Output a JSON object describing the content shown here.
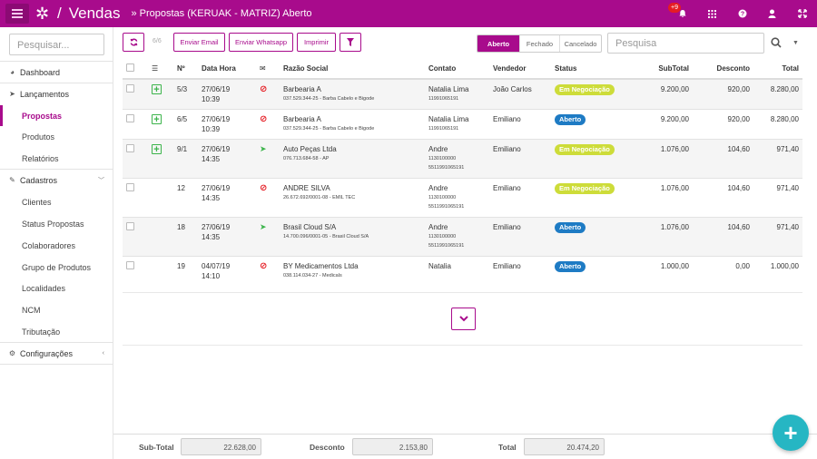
{
  "app": {
    "name": "Vendas",
    "breadcrumb": "» Propostas (KERUAK - MATRIZ) Aberto",
    "slash": "/"
  },
  "topbar": {
    "notification_count": "+9",
    "icons": [
      "bell-icon",
      "grid-icon",
      "help-icon",
      "user-icon",
      "expand-icon"
    ]
  },
  "sidebar": {
    "search_placeholder": "Pesquisar...",
    "items": [
      {
        "label": "Dashboard",
        "icon": "dashboard-icon"
      },
      {
        "label": "Lançamentos",
        "icon": "send-icon"
      },
      {
        "label": "Propostas"
      },
      {
        "label": "Produtos"
      },
      {
        "label": "Relatórios"
      },
      {
        "label": "Cadastros",
        "icon": "edit-icon"
      },
      {
        "label": "Clientes"
      },
      {
        "label": "Status Propostas"
      },
      {
        "label": "Colaboradores"
      },
      {
        "label": "Grupo de Produtos"
      },
      {
        "label": "Localidades"
      },
      {
        "label": "NCM"
      },
      {
        "label": "Tributação"
      },
      {
        "label": "Configurações",
        "icon": "gear-icon"
      }
    ]
  },
  "toolbar": {
    "count": "6/6",
    "email": "Enviar Email",
    "whatsapp": "Enviar Whatsapp",
    "print": "Imprimir",
    "status_filter": [
      "Aberto",
      "Fechado",
      "Cancelado"
    ],
    "search_placeholder": "Pesquisa"
  },
  "table": {
    "headers": {
      "num": "Nº",
      "date": "Data Hora",
      "company": "Razão Social",
      "contact": "Contato",
      "seller": "Vendedor",
      "status": "Status",
      "subtotal": "SubTotal",
      "discount": "Desconto",
      "total": "Total"
    },
    "rows": [
      {
        "num": "5/3",
        "date": "27/06/19",
        "time": "10:39",
        "company": "Barbearia A",
        "company_detail": "037.529.344-25 - Barba Cabelo e Bigode",
        "contact": "Natalia Lima",
        "contact_lines": [
          "11991065191"
        ],
        "seller": "João Carlos",
        "status": "Em Negociação",
        "subtotal": "9.200,00",
        "discount": "920,00",
        "total": "8.280,00"
      },
      {
        "num": "6/5",
        "date": "27/06/19",
        "time": "10:39",
        "company": "Barbearia A",
        "company_detail": "037.529.344-25 - Barba Cabelo e Bigode",
        "contact": "Natalia Lima",
        "contact_lines": [
          "11991065191"
        ],
        "seller": "Emiliano",
        "status": "Aberto",
        "subtotal": "9.200,00",
        "discount": "920,00",
        "total": "8.280,00"
      },
      {
        "num": "9/1",
        "date": "27/06/19",
        "time": "14:35",
        "company": "Auto Peças Ltda",
        "company_detail": "076.713.684-58 - AP",
        "contact": "Andre",
        "contact_lines": [
          "1130100000",
          "5511991065191"
        ],
        "seller": "Emiliano",
        "status": "Em Negociação",
        "subtotal": "1.076,00",
        "discount": "104,60",
        "total": "971,40"
      },
      {
        "num": "12",
        "date": "27/06/19",
        "time": "14:35",
        "company": "ANDRE SILVA",
        "company_detail": "26.672.692/0001-08 - EMIL TEC",
        "contact": "Andre",
        "contact_lines": [
          "1130100000",
          "5511991065191"
        ],
        "seller": "Emiliano",
        "status": "Em Negociação",
        "subtotal": "1.076,00",
        "discount": "104,60",
        "total": "971,40"
      },
      {
        "num": "18",
        "date": "27/06/19",
        "time": "14:35",
        "company": "Brasil Cloud S/A",
        "company_detail": "14.700.096/0001-05 - Brasil Cloud S/A",
        "contact": "Andre",
        "contact_lines": [
          "1130100000",
          "5511991065191"
        ],
        "seller": "Emiliano",
        "status": "Aberto",
        "subtotal": "1.076,00",
        "discount": "104,60",
        "total": "971,40"
      },
      {
        "num": "19",
        "date": "04/07/19",
        "time": "14:10",
        "company": "BY Medicamentos Ltda",
        "company_detail": "038.114.034-27 - Medicals",
        "contact": "Natalia",
        "contact_lines": [],
        "seller": "Emiliano",
        "status": "Aberto",
        "subtotal": "1.000,00",
        "discount": "0,00",
        "total": "1.000,00"
      }
    ]
  },
  "footer": {
    "subtotal_label": "Sub-Total",
    "subtotal": "22.628,00",
    "discount_label": "Desconto",
    "discount": "2.153,80",
    "total_label": "Total",
    "total": "20.474,20"
  },
  "colors": {
    "brand": "#a80b8c",
    "status_negotiation": "#cddc39",
    "status_open": "#1e7bc4",
    "fab": "#26b6c3"
  }
}
